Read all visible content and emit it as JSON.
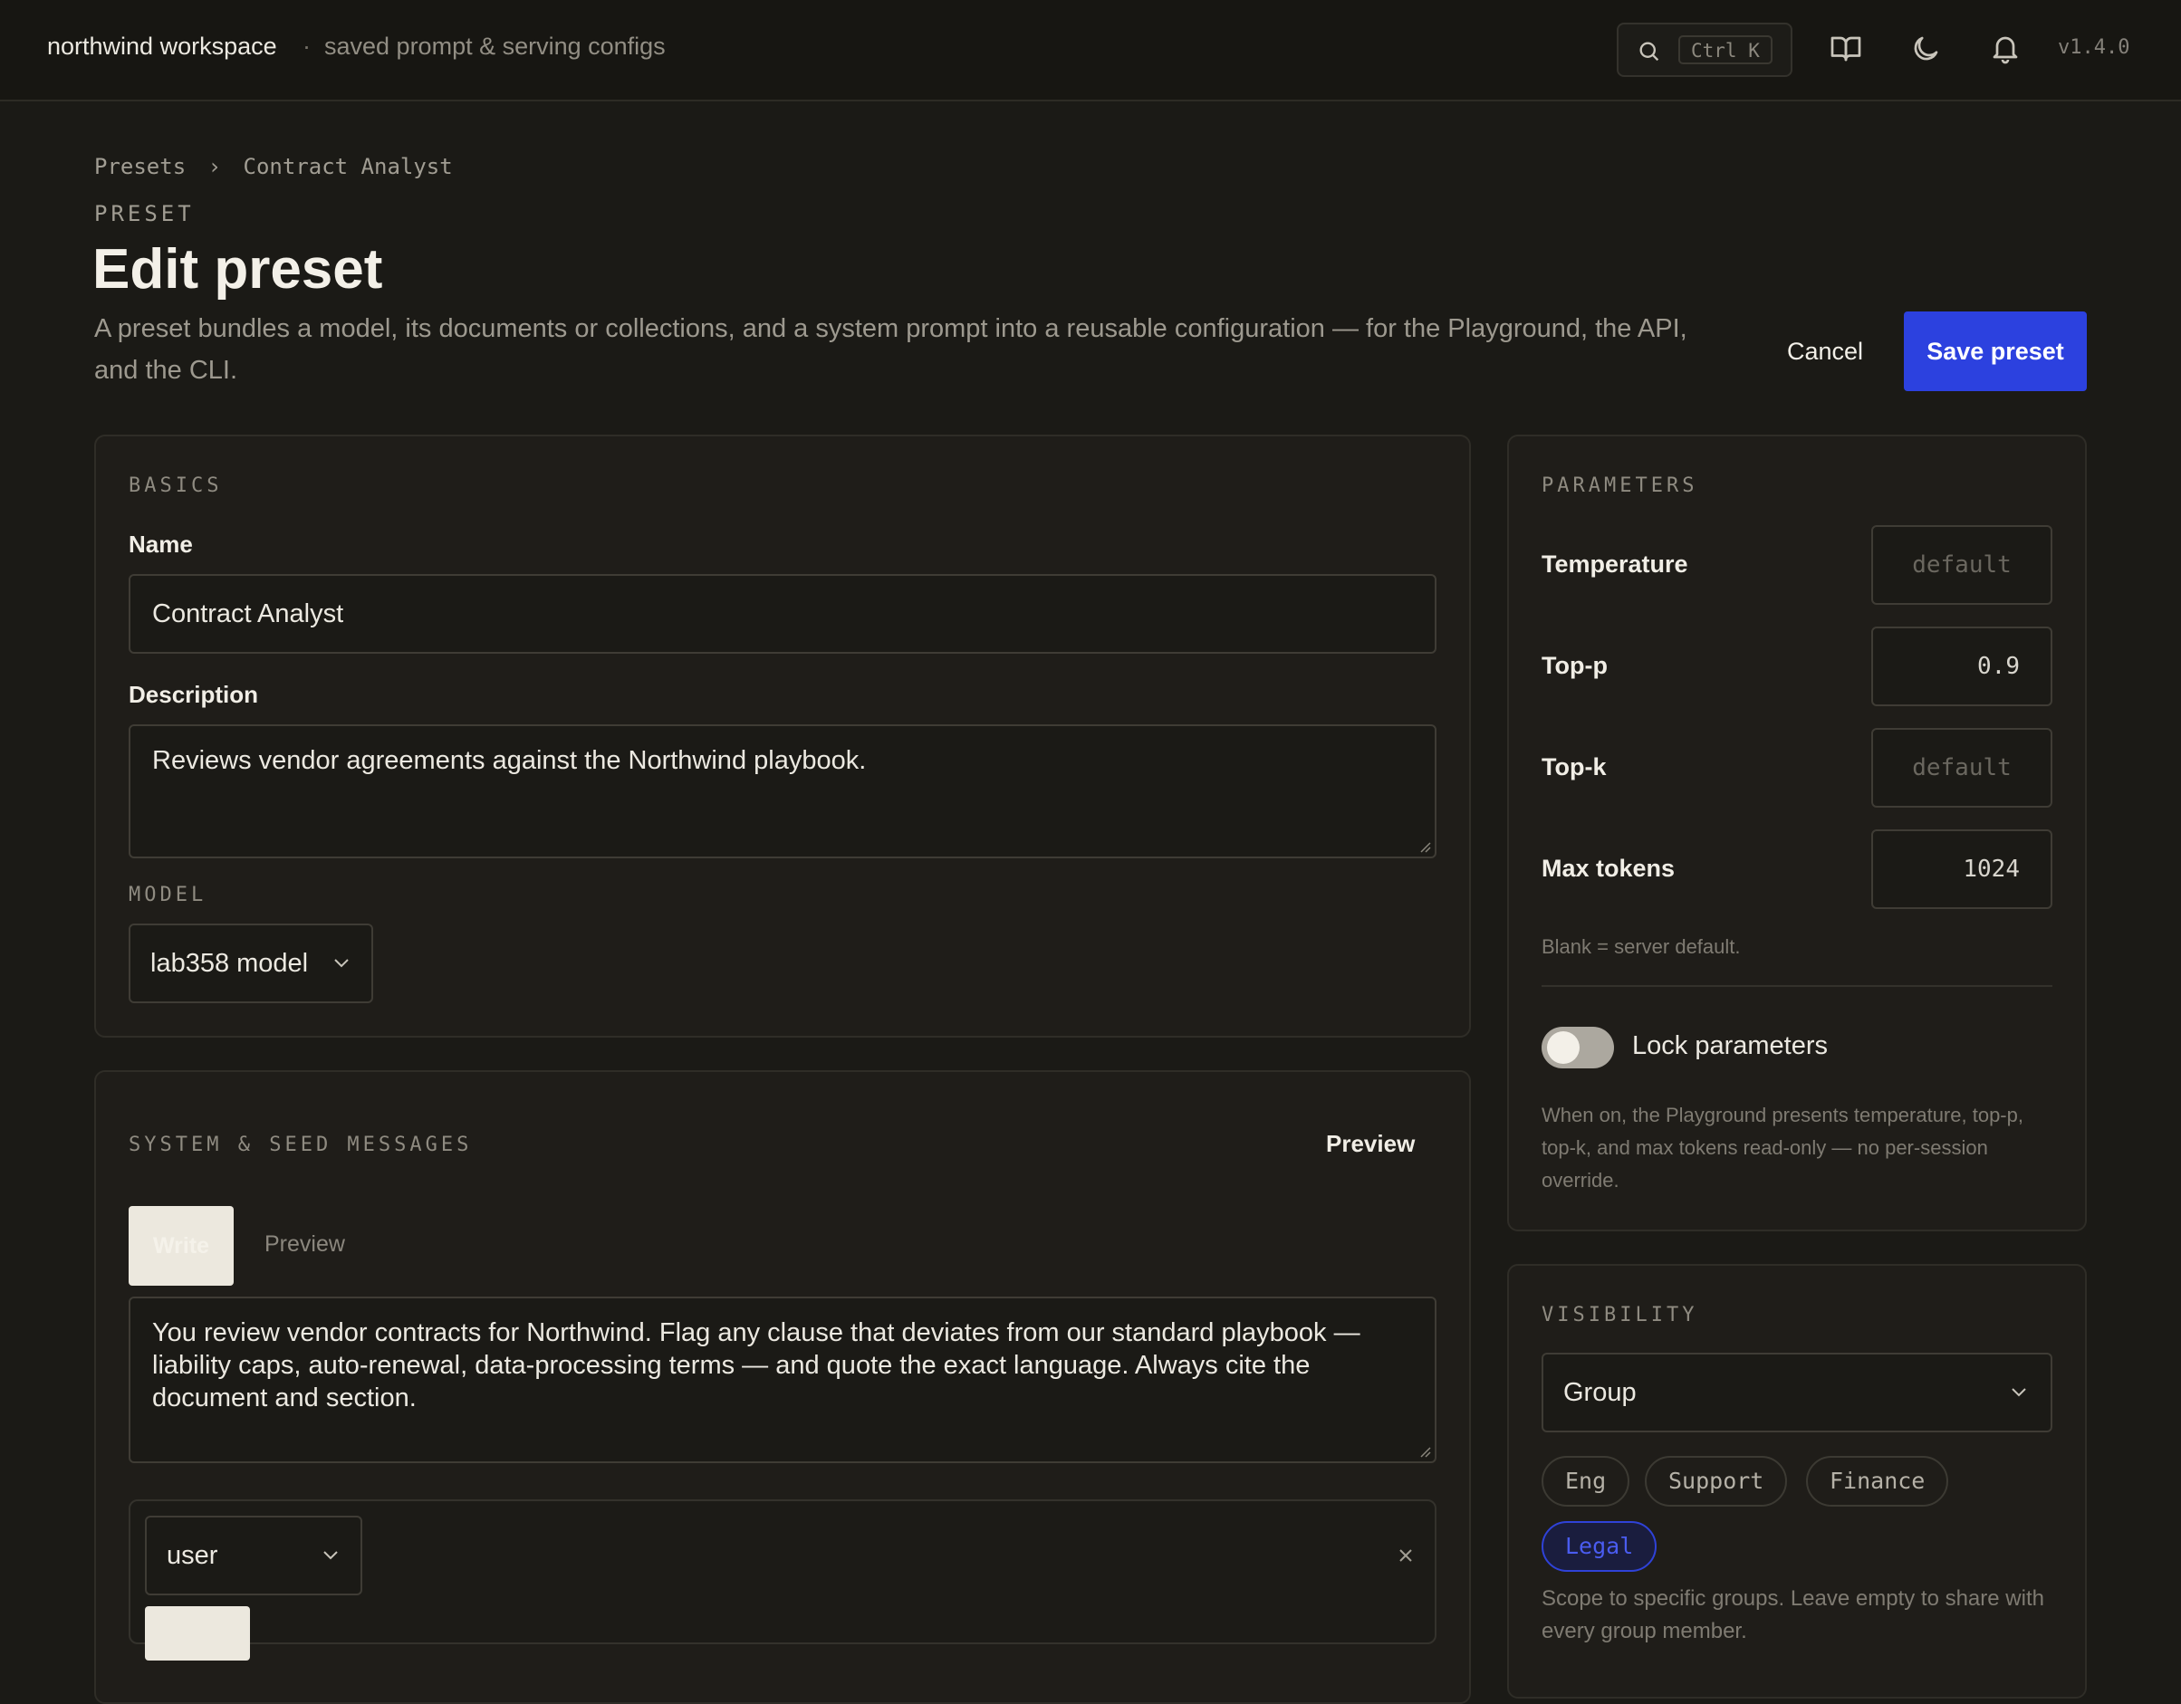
{
  "topbar": {
    "brand": "northwind workspace",
    "separator": "·",
    "subtitle": "saved prompt & serving configs",
    "search_shortcut": "Ctrl K",
    "version": "v1.4.0"
  },
  "header": {
    "breadcrumb_root": "Presets",
    "breadcrumb_sep": "›",
    "breadcrumb_current": "Contract Analyst",
    "eyebrow": "PRESET",
    "title": "Edit preset",
    "lead": "A preset bundles a model, its documents or collections, and a system prompt into a reusable configuration — for the Playground, the API, and the CLI.",
    "cancel_label": "Cancel",
    "save_label": "Save preset"
  },
  "basics": {
    "section": "BASICS",
    "name_label": "Name",
    "name_value": "Contract Analyst",
    "description_label": "Description",
    "description_value": "Reviews vendor agreements against the Northwind playbook.",
    "model_label": "MODEL",
    "model_value": "lab358 model"
  },
  "messages": {
    "section": "SYSTEM & SEED MESSAGES",
    "preview_toggle": "Preview",
    "tab_write": "Write",
    "tab_preview": "Preview",
    "system_prompt": "You review vendor contracts for Northwind. Flag any clause that deviates from our standard playbook — liability caps, auto-renewal, data-processing terms — and quote the exact language. Always cite the document and section.",
    "seed_role": "user"
  },
  "parameters": {
    "section": "PARAMETERS",
    "items": [
      {
        "label": "Temperature",
        "value": "",
        "placeholder": "default"
      },
      {
        "label": "Top-p",
        "value": "0.9",
        "placeholder": ""
      },
      {
        "label": "Top-k",
        "value": "",
        "placeholder": "default"
      },
      {
        "label": "Max tokens",
        "value": "1024",
        "placeholder": ""
      }
    ],
    "hint": "Blank = server default.",
    "lock_label": "Lock parameters",
    "lock_on": false,
    "lock_hint": "When on, the Playground presents temperature, top-p, top-k, and max tokens read-only — no per-session override."
  },
  "visibility": {
    "section": "VISIBILITY",
    "value": "Group",
    "groups": [
      {
        "label": "Eng",
        "selected": false
      },
      {
        "label": "Support",
        "selected": false
      },
      {
        "label": "Finance",
        "selected": false
      },
      {
        "label": "Legal",
        "selected": true
      }
    ],
    "hint": "Scope to specific groups. Leave empty to share with every group member."
  },
  "colors": {
    "accent": "#2c41df",
    "background": "#1b1a16",
    "card": "#1f1d19"
  }
}
